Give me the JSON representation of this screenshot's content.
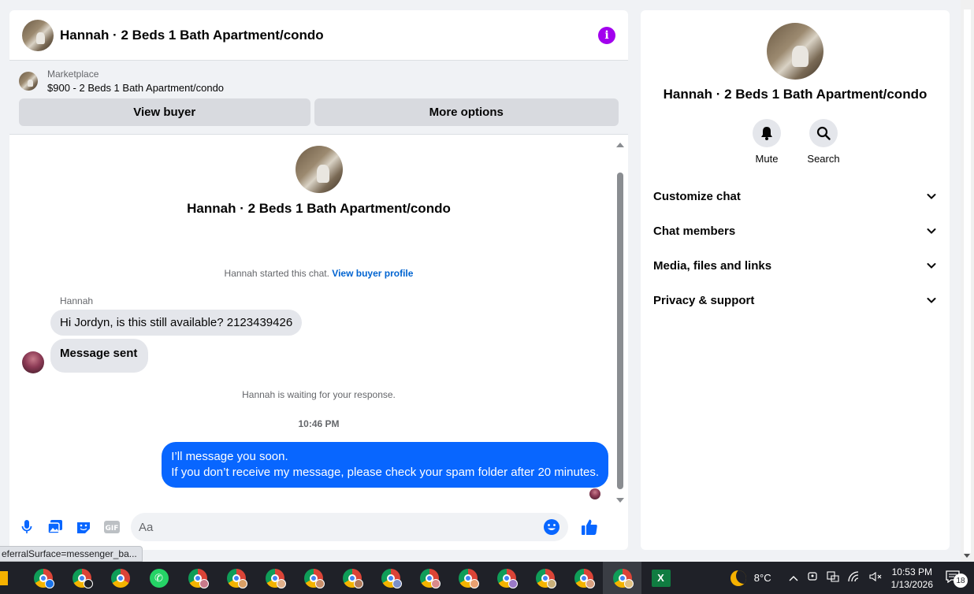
{
  "chat": {
    "title": "Hannah · 2 Beds 1 Bath Apartment/condo",
    "listing": {
      "label": "Marketplace",
      "price_title": "$900 - 2 Beds 1 Bath Apartment/condo"
    },
    "buttons": {
      "view_buyer": "View buyer",
      "more_options": "More options"
    },
    "intro_name": "Hannah · 2 Beds 1 Bath Apartment/condo",
    "started_text": "Hannah started this chat.",
    "started_link": "View buyer profile",
    "sender_name": "Hannah",
    "incoming": [
      "Hi Jordyn, is this still available? 2123439426",
      "Message sent"
    ],
    "waiting_text": "Hannah is waiting for your response.",
    "timestamp": "10:46 PM",
    "outgoing": {
      "line1": "I’ll message you soon.",
      "line2": "If you don’t receive my message, please check your spam folder after 20 minutes."
    },
    "composer": {
      "placeholder": "Aa"
    },
    "accent": "#0866ff",
    "info_color": "#a200ee"
  },
  "info_panel": {
    "name": "Hannah · 2 Beds 1 Bath Apartment/condo",
    "actions": [
      {
        "label": "Mute",
        "icon": "bell-icon"
      },
      {
        "label": "Search",
        "icon": "search-icon"
      }
    ],
    "sections": [
      "Customize chat",
      "Chat members",
      "Media, files and links",
      "Privacy & support"
    ]
  },
  "status_url": "eferralSurface=messenger_ba...",
  "taskbar": {
    "temperature": "8°C",
    "time": "10:53 PM",
    "date": "1/13/2026",
    "notifications": "18",
    "excel_label": "X"
  }
}
